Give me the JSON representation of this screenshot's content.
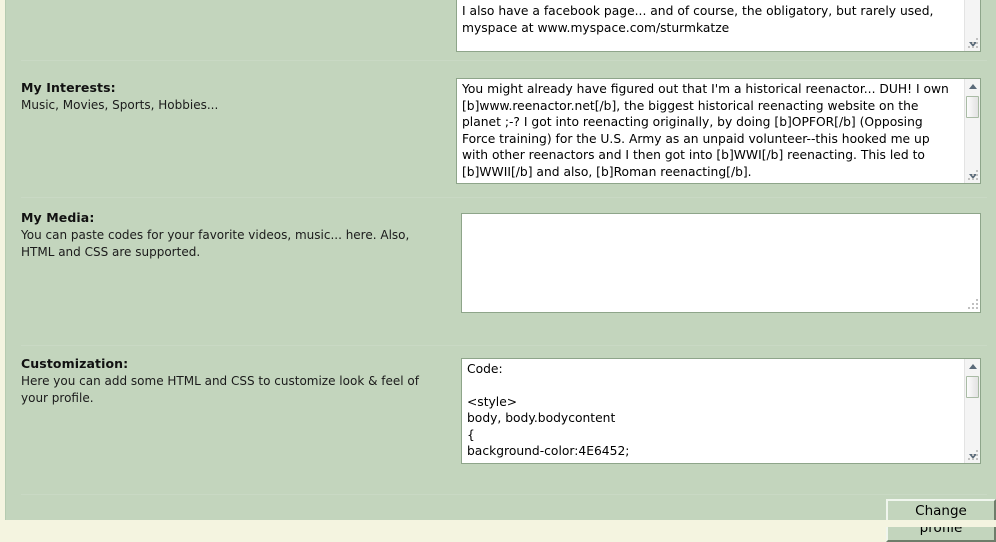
{
  "page": {
    "background_color": "#c3d5bd",
    "outer_color": "#f4f4e0"
  },
  "sections": [
    {
      "id": "top-partial",
      "title": "",
      "description": "",
      "textarea_value": "I also have a facebook page... and of course, the obligatory, but rarely used, myspace at www.myspace.com/sturmkatze",
      "has_scrollbar": true
    },
    {
      "id": "my-interests",
      "title": "My Interests:",
      "description": "Music, Movies, Sports, Hobbies...",
      "textarea_value": "You might already have figured out that I'm a historical reenactor... DUH! I own [b]www.reenactor.net[/b], the biggest historical reenacting website on the planet ;-? I got into reenacting originally, by doing [b]OPFOR[/b] (Opposing Force training) for the U.S. Army as an unpaid volunteer--this hooked me up with other reenactors and I then got into [b]WWI[/b] reenacting. This led to [b]WWII[/b] and also, [b]Roman reenacting[/b].",
      "has_scrollbar": true
    },
    {
      "id": "my-media",
      "title": "My Media:",
      "description": "You can paste codes for your favorite videos, music... here. Also, HTML and CSS are supported.",
      "textarea_value": "",
      "has_scrollbar": false
    },
    {
      "id": "customization",
      "title": "Customization:",
      "description": "Here you can add some HTML and CSS to customize look & feel of your profile.",
      "textarea_value": "Code:\n\n<style>\nbody, body.bodycontent\n{\nbackground-color:4E6452;",
      "has_scrollbar": true
    }
  ],
  "footer": {
    "submit_label": "Change profile"
  }
}
